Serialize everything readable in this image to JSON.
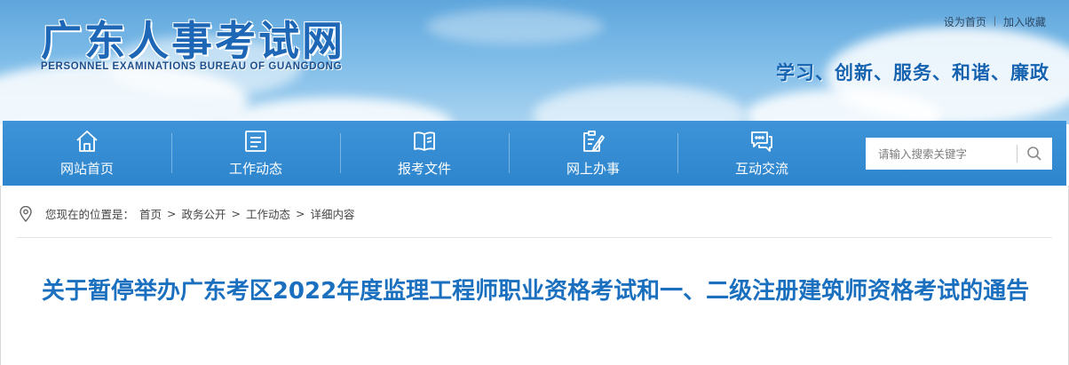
{
  "header": {
    "logo_cn": "广东人事考试网",
    "logo_en": "PERSONNEL EXAMINATIONS BUREAU OF GUANGDONG",
    "top_links": {
      "set_home": "设为首页",
      "separator": "|",
      "bookmark": "加入收藏"
    },
    "slogan": "学习、创新、服务、和谐、廉政"
  },
  "nav": {
    "items": [
      {
        "label": "网站首页",
        "icon": "home-icon"
      },
      {
        "label": "工作动态",
        "icon": "news-icon"
      },
      {
        "label": "报考文件",
        "icon": "book-icon"
      },
      {
        "label": "网上办事",
        "icon": "form-edit-icon"
      },
      {
        "label": "互动交流",
        "icon": "chat-icon"
      }
    ],
    "search": {
      "placeholder": "请输入搜索关键字",
      "value": "",
      "icon": "search-icon"
    }
  },
  "breadcrumb": {
    "icon": "location-pin-icon",
    "prefix": "您现在的位置是：",
    "items": [
      "首页",
      "政务公开",
      "工作动态",
      "详细内容"
    ],
    "separator": ">"
  },
  "article": {
    "title": "关于暂停举办广东考区2022年度监理工程师职业资格考试和一、二级注册建筑师资格考试的通告"
  },
  "colors": {
    "nav_bg": "#3f94d8",
    "title": "#1b6fbf",
    "logo": "#1e67b6"
  }
}
